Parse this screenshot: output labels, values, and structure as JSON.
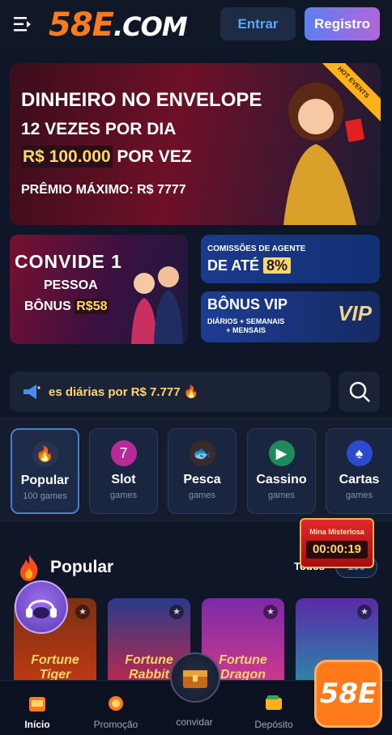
{
  "header": {
    "logo_main": "58E",
    "logo_suffix": ".COM",
    "login_label": "Entrar",
    "register_label": "Registro"
  },
  "hero": {
    "line1": "DINHEIRO NO ENVELOPE",
    "line2": "12 VEZES POR DIA",
    "line3_amount": "R$ 100.000",
    "line3_rest": " POR VEZ",
    "line4": "PRÊMIO MÁXIMO: R$ 7777",
    "badge": "HOT EVENTS"
  },
  "promo_invite": {
    "line1": "CONVIDE 1",
    "line2": "PESSOA",
    "line3": "BÔNUS ",
    "amount": "R$58"
  },
  "promo_agent": {
    "line1": "COMISSÕES DE AGENTE",
    "line2": "DE ATÉ ",
    "pct": "8%"
  },
  "promo_vip": {
    "line1": "BÔNUS VIP",
    "line2a": "DIÁRIOS + SEMANAIS",
    "line2b": "+ MENSAIS",
    "logo": "VIP"
  },
  "marquee": {
    "text": "es diárias por R$ 7.777 🔥"
  },
  "categories": [
    {
      "name": "Popular",
      "sub": "100 games"
    },
    {
      "name": "Slot",
      "sub": "games"
    },
    {
      "name": "Pesca",
      "sub": "games"
    },
    {
      "name": "Cassino",
      "sub": "games"
    },
    {
      "name": "Cartas",
      "sub": "games"
    }
  ],
  "popular": {
    "title": "Popular",
    "todos": "Todos",
    "count": "100"
  },
  "games": [
    {
      "name": "Fortune Tiger"
    },
    {
      "name": "Fortune Rabbit"
    },
    {
      "name": "Fortune Dragon"
    },
    {
      "name": ""
    }
  ],
  "mystery": {
    "label": "Mina Misteriosa",
    "timer": "00:00:19"
  },
  "brand_float": "58E",
  "nav": [
    {
      "label": "Início"
    },
    {
      "label": "Promoção"
    },
    {
      "label": "convidar"
    },
    {
      "label": "Depósito"
    }
  ]
}
